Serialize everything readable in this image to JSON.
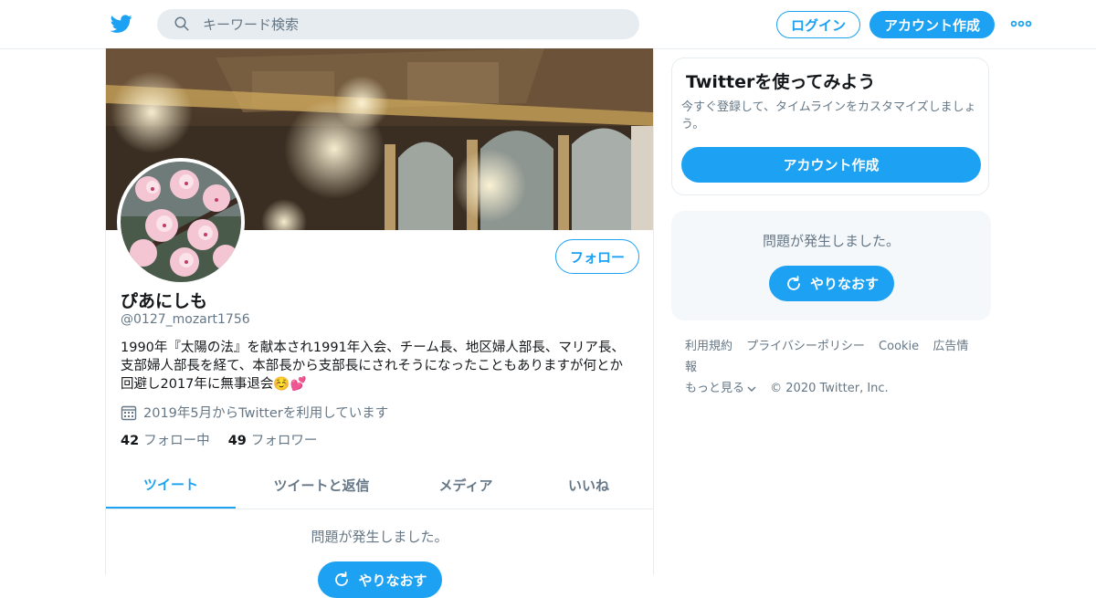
{
  "header": {
    "search_placeholder": "キーワード検索",
    "login_label": "ログイン",
    "signup_label": "アカウント作成"
  },
  "profile": {
    "name": "ぴあにしも",
    "handle": "@0127_mozart1756",
    "bio": "1990年『太陽の法』を献本され1991年入会、チーム長、地区婦人部長、マリア長、支部婦人部長を経て、本部長から支部長にされそうになったこともありますが何とか回避し2017年に無事退会☺️💕",
    "joined": "2019年5月からTwitterを利用しています",
    "following_count": "42",
    "following_label": "フォロー中",
    "followers_count": "49",
    "followers_label": "フォロワー",
    "follow_label": "フォロー"
  },
  "tabs": [
    {
      "label": "ツイート",
      "active": true
    },
    {
      "label": "ツイートと返信",
      "active": false
    },
    {
      "label": "メディア",
      "active": false
    },
    {
      "label": "いいね",
      "active": false
    }
  ],
  "main_error": {
    "message": "問題が発生しました。",
    "retry_label": "やりなおす"
  },
  "sidebar": {
    "signup_card": {
      "title": "Twitterを使ってみよう",
      "description": "今すぐ登録して、タイムラインをカスタマイズしましょう。",
      "button_label": "アカウント作成"
    },
    "error_card": {
      "message": "問題が発生しました。",
      "retry_label": "やりなおす"
    },
    "footer": {
      "links": [
        "利用規約",
        "プライバシーポリシー",
        "Cookie",
        "広告情報"
      ],
      "more_label": "もっと見る",
      "copyright": "© 2020 Twitter, Inc."
    }
  },
  "colors": {
    "brand": "#1da1f2",
    "text_secondary": "#657786",
    "border": "#e6ecf0"
  }
}
